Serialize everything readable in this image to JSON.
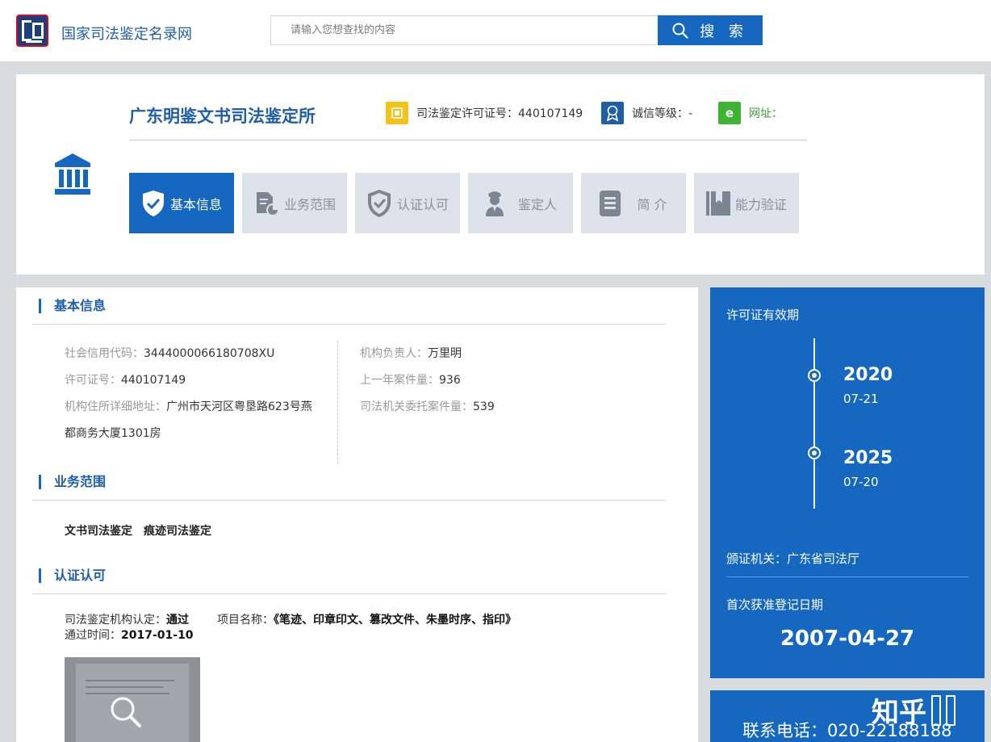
{
  "site": {
    "title": "国家司法鉴定名录网"
  },
  "search": {
    "placeholder": "请输入您想查找的内容",
    "button_label": "搜 索"
  },
  "org": {
    "name": "广东明鉴文书司法鉴定所",
    "license_label": "司法鉴定许可证号：440107149",
    "credit_label": "诚信等级：-",
    "website_label": "网址："
  },
  "tabs": [
    {
      "label": "基本信息",
      "icon": "shield-check-icon",
      "active": true
    },
    {
      "label": "业务范围",
      "icon": "document-chart-icon",
      "active": false
    },
    {
      "label": "认证认可",
      "icon": "shield-check-icon",
      "active": false
    },
    {
      "label": "鉴定人",
      "icon": "officer-icon",
      "active": false
    },
    {
      "label": "简 介",
      "icon": "list-document-icon",
      "active": false
    },
    {
      "label": "能力验证",
      "icon": "book-icon",
      "active": false
    }
  ],
  "basic": {
    "title": "基本信息",
    "credit_code_label": "社会信用代码：",
    "credit_code_value": "3444000066180708XU",
    "license_label": "许可证号：",
    "license_value": "440107149",
    "address_label": "机构住所详细地址：",
    "address_value_1": "广州市天河区粤垦路623号燕",
    "address_value_2": "都商务大厦1301房",
    "leader_label": "机构负责人：",
    "leader_value": "万里明",
    "last_year_label": "上一年案件量：",
    "last_year_value": "936",
    "judicial_label": "司法机关委托案件量：",
    "judicial_value": "539"
  },
  "scope": {
    "title": "业务范围",
    "items": [
      "文书司法鉴定",
      "痕迹司法鉴定"
    ]
  },
  "cert": {
    "title": "认证认可",
    "org_cert_label": "司法鉴定机构认定：",
    "org_cert_value": "通过",
    "project_label": "项目名称：",
    "project_value": "《笔迹、印章印文、篡改文件、朱墨时序、指印》",
    "pass_time_label": "通过时间：",
    "pass_time_value": "2017-01-10"
  },
  "side": {
    "validity_title": "许可证有效期",
    "start_year": "2020",
    "start_date": "07-21",
    "end_year": "2025",
    "end_date": "07-20",
    "issuer": "颁证机关：广东省司法厅",
    "first_reg_label": "首次获准登记日期",
    "first_reg_date": "2007-04-27"
  },
  "contact": {
    "phone": "联系电话：020-22188188"
  },
  "watermark": {
    "text": "知乎"
  },
  "colors": {
    "primary": "#1567c0",
    "title_blue": "#1f5ea8",
    "tab_inactive": "#dde3ea",
    "website_green": "#3aa13a"
  }
}
